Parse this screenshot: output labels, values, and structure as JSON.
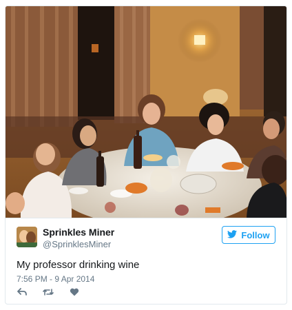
{
  "tweet": {
    "author_name": "Sprinkles Miner",
    "author_handle": "@SprinklesMiner",
    "follow_label": "Follow",
    "text": "My professor drinking wine",
    "timestamp": "7:56 PM - 9 Apr 2014"
  },
  "icons": {
    "follow": "twitter-bird-icon",
    "reply": "reply-icon",
    "retweet": "retweet-icon",
    "like": "heart-icon"
  },
  "colors": {
    "accent": "#1da1f2",
    "text_primary": "#14171a",
    "text_secondary": "#657786",
    "border": "#e1e8ed"
  }
}
